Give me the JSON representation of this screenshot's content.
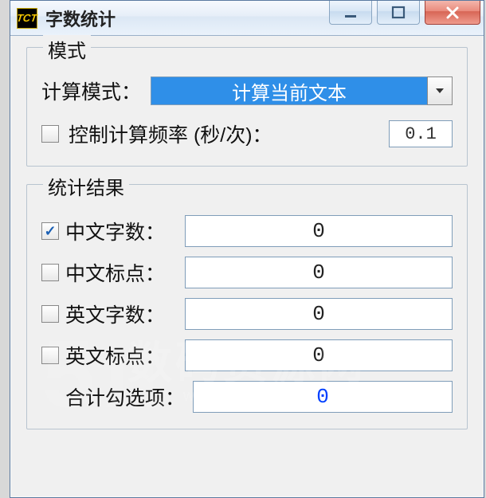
{
  "window": {
    "title": "字数统计"
  },
  "mode": {
    "legend": "模式",
    "calc_mode_label": "计算模式：",
    "calc_mode_value": "计算当前文本",
    "freq_label": "控制计算频率 (秒/次)：",
    "freq_checked": false,
    "freq_value": "0.1"
  },
  "results": {
    "legend": "统计结果",
    "rows": [
      {
        "label": "中文字数：",
        "checked": true,
        "value": "0"
      },
      {
        "label": "中文标点：",
        "checked": false,
        "value": "0"
      },
      {
        "label": "英文字数：",
        "checked": false,
        "value": "0"
      },
      {
        "label": "英文标点：",
        "checked": false,
        "value": "0"
      }
    ],
    "total_label": "合计勾选项：",
    "total_value": "0"
  },
  "watermark": {
    "text_main": "数码资源网",
    "text_sub": "www.smzy.com"
  }
}
